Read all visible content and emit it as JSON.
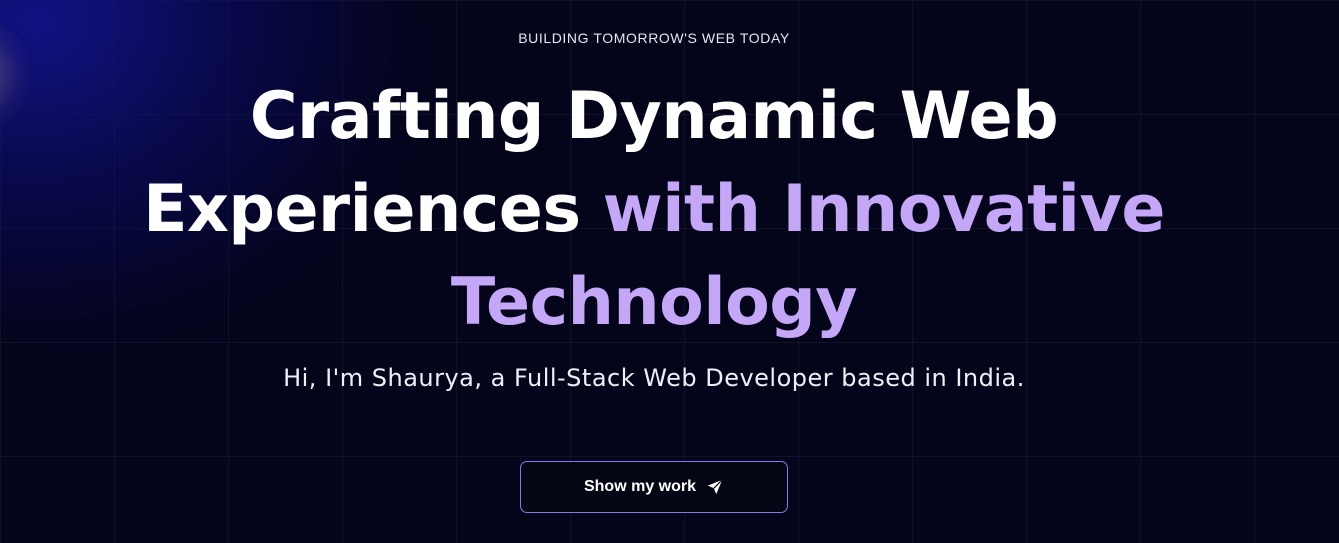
{
  "hero": {
    "eyebrow": "BUILDING TOMORROW'S WEB TODAY",
    "headline_line1": "Crafting Dynamic Web",
    "headline_line2_plain": "Experiences ",
    "headline_line2_accent": "with Innovative",
    "headline_line3_accent": "Technology",
    "subtitle": "Hi, I'm Shaurya, a Full-Stack Web Developer based in India.",
    "cta_label": "Show my work",
    "cta_icon": "paper-plane-icon"
  },
  "colors": {
    "background": "#04041a",
    "accent": "#c4a8f7",
    "button_border": "#8b7ae8",
    "glow": "#141496"
  }
}
